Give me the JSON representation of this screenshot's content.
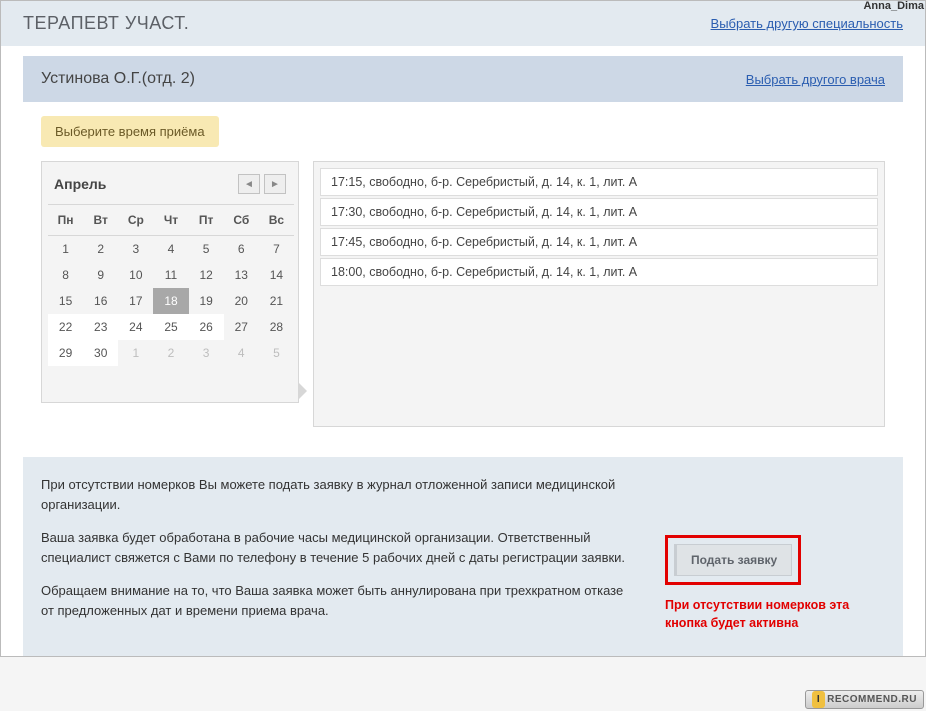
{
  "watermark": {
    "user": "Anna_Dima",
    "site_i": "I",
    "site": "RECOMMEND.RU"
  },
  "hdr1": {
    "title": "ТЕРАПЕВТ УЧАСТ.",
    "link": "Выбрать другую специальность"
  },
  "hdr2": {
    "title": "Устинова О.Г.(отд. 2)",
    "link": "Выбрать другого врача"
  },
  "hint": "Выберите время приёма",
  "calendar": {
    "month": "Апрель",
    "prev": "◄",
    "next": "►",
    "dow": [
      "Пн",
      "Вт",
      "Ср",
      "Чт",
      "Пт",
      "Сб",
      "Вс"
    ],
    "weeks": [
      [
        {
          "d": "1"
        },
        {
          "d": "2"
        },
        {
          "d": "3"
        },
        {
          "d": "4"
        },
        {
          "d": "5"
        },
        {
          "d": "6"
        },
        {
          "d": "7"
        }
      ],
      [
        {
          "d": "8"
        },
        {
          "d": "9"
        },
        {
          "d": "10"
        },
        {
          "d": "11"
        },
        {
          "d": "12"
        },
        {
          "d": "13"
        },
        {
          "d": "14"
        }
      ],
      [
        {
          "d": "15"
        },
        {
          "d": "16"
        },
        {
          "d": "17"
        },
        {
          "d": "18",
          "sel": true
        },
        {
          "d": "19"
        },
        {
          "d": "20"
        },
        {
          "d": "21"
        }
      ],
      [
        {
          "d": "22",
          "avail": true
        },
        {
          "d": "23",
          "avail": true
        },
        {
          "d": "24",
          "avail": true
        },
        {
          "d": "25",
          "avail": true
        },
        {
          "d": "26",
          "avail": true
        },
        {
          "d": "27"
        },
        {
          "d": "28"
        }
      ],
      [
        {
          "d": "29",
          "avail": true
        },
        {
          "d": "30",
          "avail": true
        },
        {
          "d": "1",
          "other": true
        },
        {
          "d": "2",
          "other": true
        },
        {
          "d": "3",
          "other": true
        },
        {
          "d": "4",
          "other": true
        },
        {
          "d": "5",
          "other": true
        }
      ]
    ]
  },
  "slots": [
    "17:15, свободно, б-р. Серебристый, д. 14, к. 1, лит. А",
    "17:30, свободно, б-р. Серебристый, д. 14, к. 1, лит. А",
    "17:45, свободно, б-р. Серебристый, д. 14, к. 1, лит. А",
    "18:00, свободно, б-р. Серебристый, д. 14, к. 1, лит. А"
  ],
  "info": {
    "p1": "При отсутствии номерков Вы можете подать заявку в журнал отложенной записи медицинской организации.",
    "p2": "Ваша заявка будет обработана в рабочие часы медицинской организации. Ответственный специалист свяжется с Вами по телефону в течение 5 рабочих дней с даты регистрации заявки.",
    "p3": "Обращаем внимание на то, что Ваша заявка может быть аннулирована при трехкратном отказе от предложенных дат и времени приема врача.",
    "button": "Подать заявку",
    "note": "При отсутствии номерков эта кнопка будет активна"
  }
}
